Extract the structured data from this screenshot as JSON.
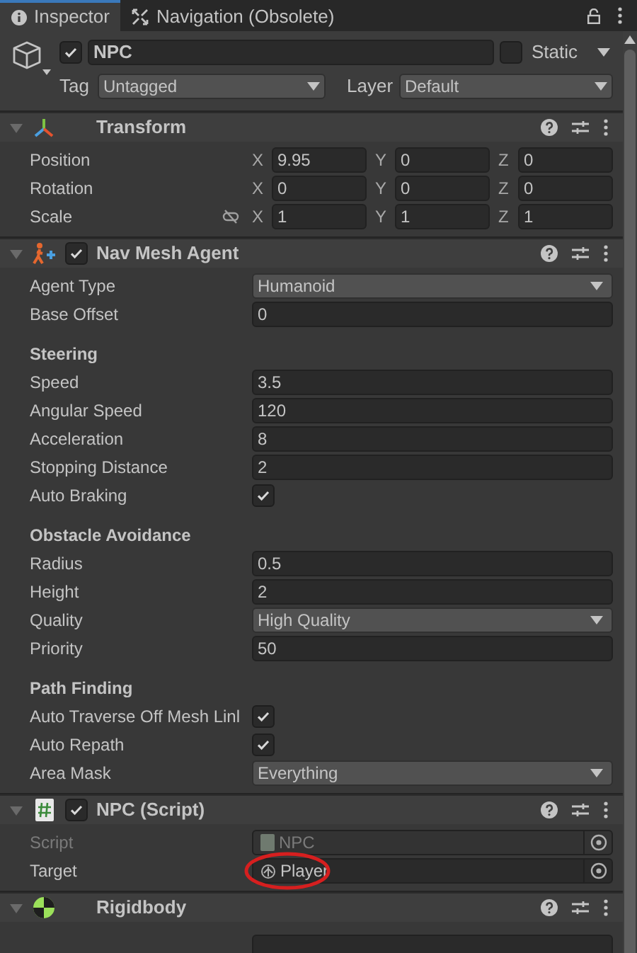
{
  "tabs": [
    {
      "label": "Inspector",
      "kind": "info",
      "selected": true
    },
    {
      "label": "Navigation (Obsolete)",
      "kind": "navigation",
      "selected": false
    }
  ],
  "game_object": {
    "active": true,
    "name": "NPC",
    "static": false,
    "static_label": "Static",
    "tag_label": "Tag",
    "tag": "Untagged",
    "layer_label": "Layer",
    "layer": "Default"
  },
  "components": [
    {
      "kind": "transform",
      "title": "Transform",
      "expanded": true,
      "rows": [
        {
          "label": "Position",
          "values": [
            {
              "axis": "X",
              "value": "9.95"
            },
            {
              "axis": "Y",
              "value": "0"
            },
            {
              "axis": "Z",
              "value": "0"
            }
          ]
        },
        {
          "label": "Rotation",
          "values": [
            {
              "axis": "X",
              "value": "0"
            },
            {
              "axis": "Y",
              "value": "0"
            },
            {
              "axis": "Z",
              "value": "0"
            }
          ]
        },
        {
          "label": "Scale",
          "linked": false,
          "values": [
            {
              "axis": "X",
              "value": "1"
            },
            {
              "axis": "Y",
              "value": "1"
            },
            {
              "axis": "Z",
              "value": "1"
            }
          ]
        }
      ]
    },
    {
      "kind": "navmesh",
      "title": "Nav Mesh Agent",
      "enabled": true,
      "expanded": true,
      "rows": [
        {
          "kind": "dropdown",
          "label": "Agent Type",
          "value": "Humanoid"
        },
        {
          "kind": "field",
          "label": "Base Offset",
          "value": "0"
        },
        {
          "kind": "heading",
          "label": "Steering"
        },
        {
          "kind": "field",
          "label": "Speed",
          "value": "3.5"
        },
        {
          "kind": "field",
          "label": "Angular Speed",
          "value": "120"
        },
        {
          "kind": "field",
          "label": "Acceleration",
          "value": "8"
        },
        {
          "kind": "field",
          "label": "Stopping Distance",
          "value": "2"
        },
        {
          "kind": "checkbox",
          "label": "Auto Braking",
          "checked": true
        },
        {
          "kind": "heading",
          "label": "Obstacle Avoidance"
        },
        {
          "kind": "field",
          "label": "Radius",
          "value": "0.5"
        },
        {
          "kind": "field",
          "label": "Height",
          "value": "2"
        },
        {
          "kind": "dropdown",
          "label": "Quality",
          "value": "High Quality"
        },
        {
          "kind": "field",
          "label": "Priority",
          "value": "50"
        },
        {
          "kind": "heading",
          "label": "Path Finding"
        },
        {
          "kind": "checkbox",
          "label": "Auto Traverse Off Mesh Linl",
          "checked": true
        },
        {
          "kind": "checkbox",
          "label": "Auto Repath",
          "checked": true
        },
        {
          "kind": "dropdown",
          "label": "Area Mask",
          "value": "Everything"
        }
      ]
    },
    {
      "kind": "script",
      "title": "NPC (Script)",
      "enabled": true,
      "expanded": true,
      "rows": [
        {
          "kind": "object",
          "label": "Script",
          "value": "NPC",
          "disabled": true,
          "highlighted": false
        },
        {
          "kind": "object",
          "label": "Target",
          "value": "Player",
          "disabled": false,
          "highlighted": true
        }
      ]
    },
    {
      "kind": "rigidbody",
      "title": "Rigidbody",
      "expanded": true,
      "rows": [
        {
          "kind": "partial"
        }
      ]
    }
  ]
}
